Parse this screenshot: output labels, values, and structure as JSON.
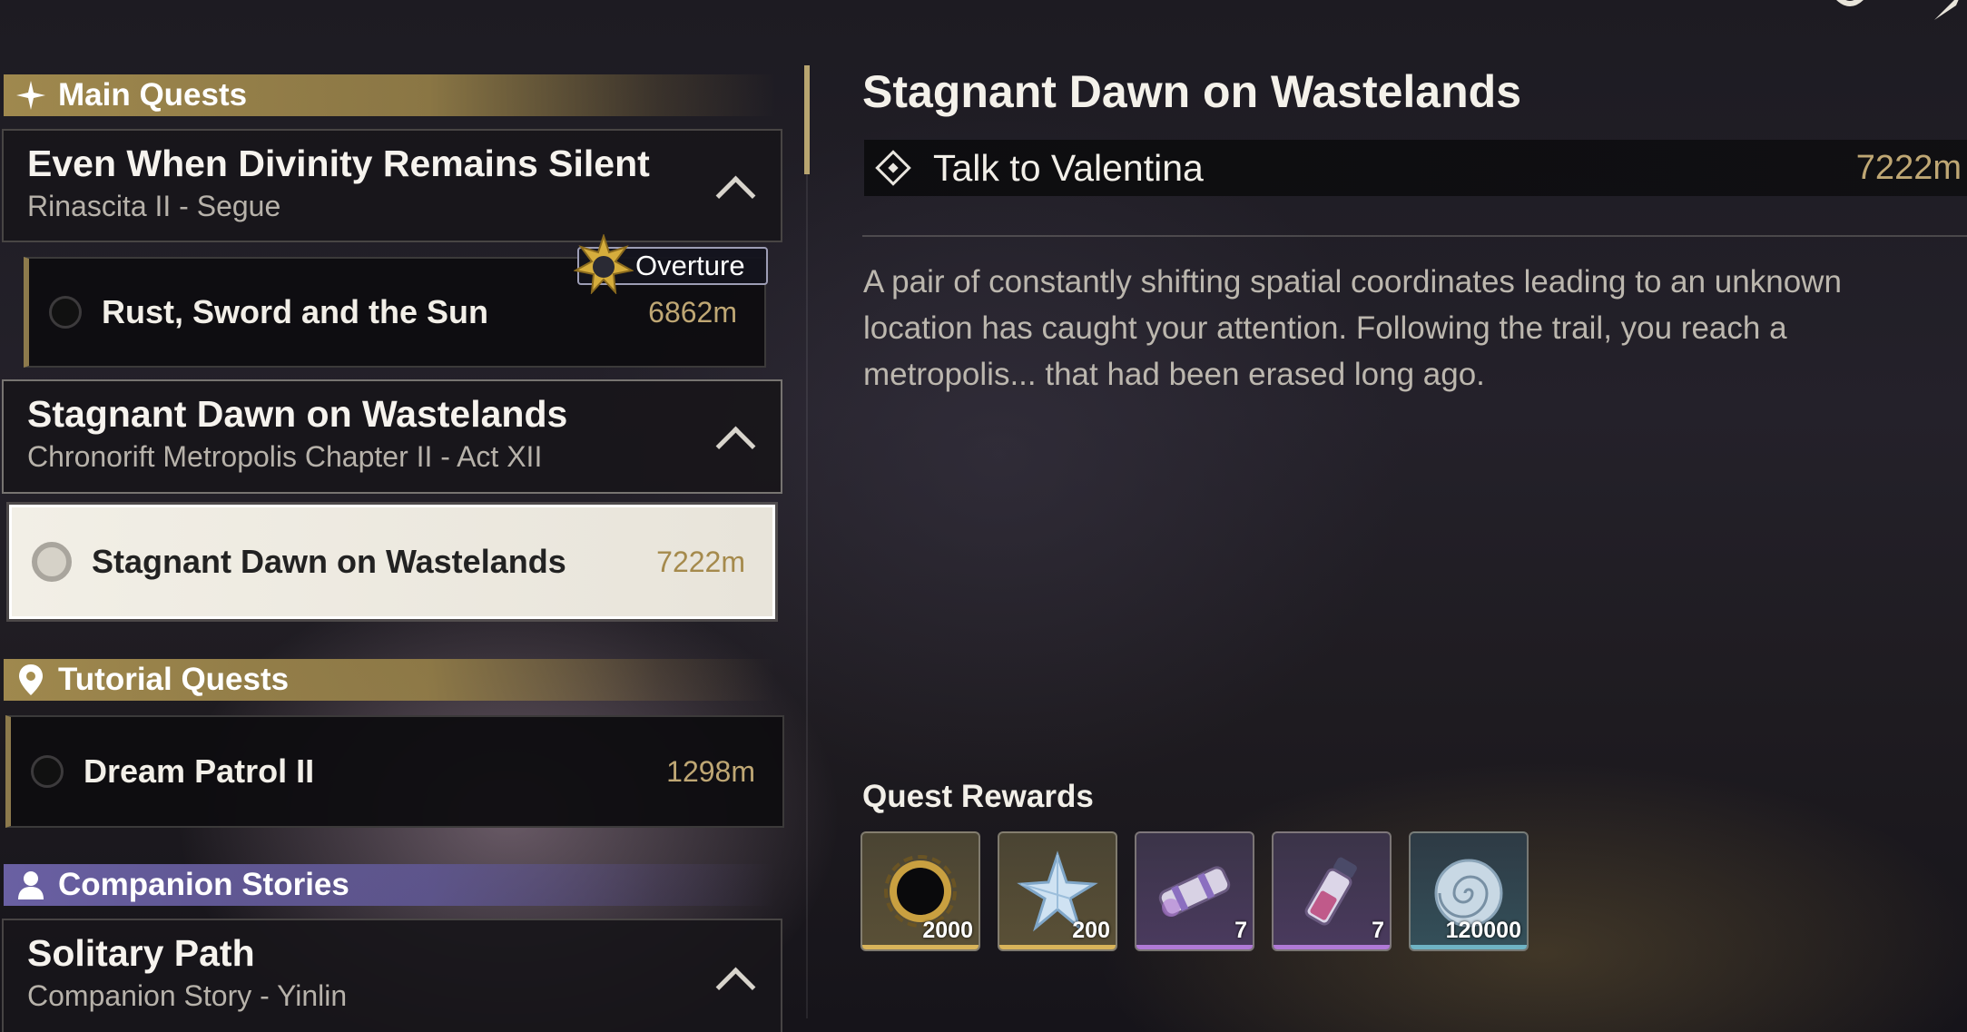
{
  "sections": {
    "main": {
      "label": "Main Quests"
    },
    "tutorial": {
      "label": "Tutorial Quests"
    },
    "companion": {
      "label": "Companion Stories"
    }
  },
  "main_groups": [
    {
      "title": "Even When Divinity Remains Silent",
      "subtitle": "Rinascita II - Segue",
      "quests": [
        {
          "name": "Rust, Sword and the Sun",
          "distance": "6862m",
          "tag": "Overture"
        }
      ]
    },
    {
      "title": "Stagnant Dawn on Wastelands",
      "subtitle": "Chronorift Metropolis Chapter II - Act XII",
      "quests": [
        {
          "name": "Stagnant Dawn on Wastelands",
          "distance": "7222m",
          "selected": true
        }
      ]
    }
  ],
  "tutorial_quests": [
    {
      "name": "Dream Patrol II",
      "distance": "1298m"
    }
  ],
  "companion_groups": [
    {
      "title": "Solitary Path",
      "subtitle": "Companion Story - Yinlin"
    }
  ],
  "detail": {
    "title": "Stagnant Dawn on Wastelands",
    "objective": "Talk to Valentina",
    "objective_distance": "7222m",
    "description": "A pair of constantly shifting spatial coordinates leading to an unknown location has caught your attention. Following the trail, you reach a metropolis... that had been erased long ago.",
    "rewards_label": "Quest Rewards",
    "rewards": [
      {
        "icon": "dark-ring-icon",
        "qty": "2000",
        "rarity_color": "#d9b45a"
      },
      {
        "icon": "star-crystal-icon",
        "qty": "200",
        "rarity_color": "#d9b45a"
      },
      {
        "icon": "purple-canister-icon",
        "qty": "7",
        "rarity_color": "#b07ad6"
      },
      {
        "icon": "purple-vial-icon",
        "qty": "7",
        "rarity_color": "#b07ad6"
      },
      {
        "icon": "shell-coin-icon",
        "qty": "120000",
        "rarity_color": "#6fb3c4"
      }
    ]
  },
  "colors": {
    "accent_gold": "#bfa774",
    "header_gold": "#a68e50",
    "header_purple": "#6e64aa"
  }
}
